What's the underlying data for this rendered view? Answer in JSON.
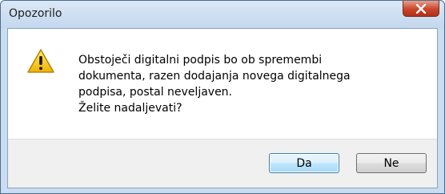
{
  "window": {
    "title": "Opozorilo",
    "close_icon": "close-icon"
  },
  "message": {
    "icon": "warning-icon",
    "lines": [
      "Obstoječi digitalni podpis bo ob spremembi",
      "dokumenta, razen dodajanja novega digitalnega",
      "podpisa, postal neveljaven.",
      "Želite nadaljevati?"
    ]
  },
  "buttons": {
    "yes_label": "Da",
    "no_label": "Ne"
  },
  "colors": {
    "warning": "#f5c211",
    "close_button": "#c9452a",
    "default_button_border": "#3c7fb1"
  }
}
